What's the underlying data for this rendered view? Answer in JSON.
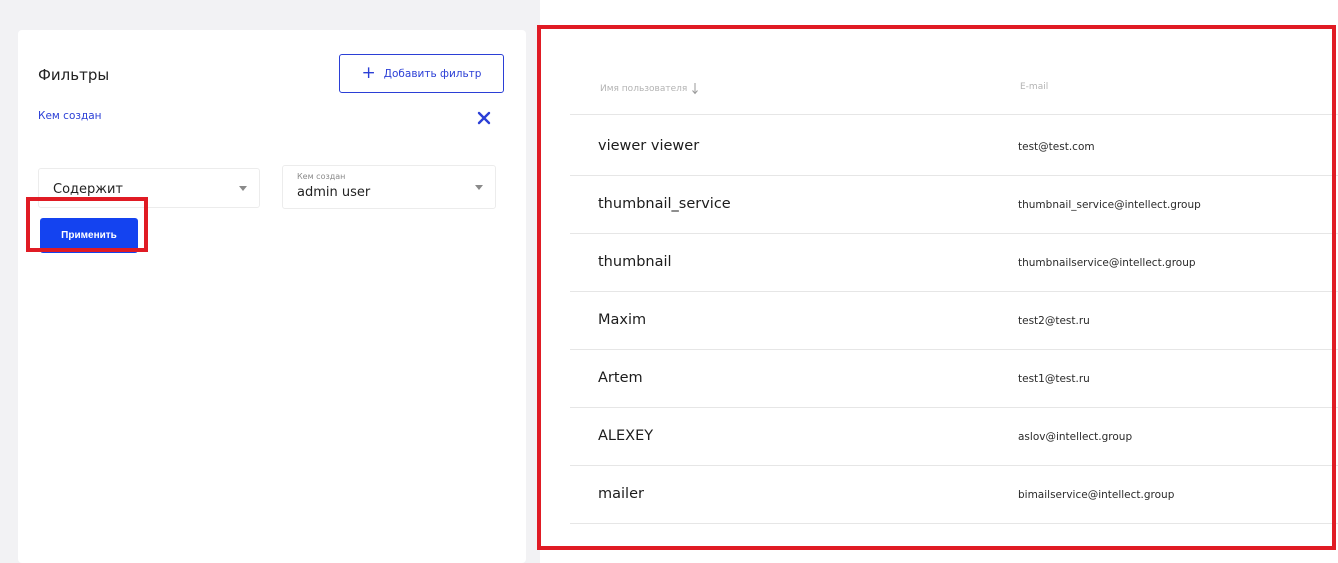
{
  "filters": {
    "title": "Фильтры",
    "add_filter_label": "Добавить фильтр",
    "add_filter_icon": "+",
    "field_name": "Кем создан",
    "condition_value": "Содержит",
    "value_floating_label": "Кем создан",
    "value_selected": "admin user",
    "apply_label": "Применить"
  },
  "table": {
    "columns": {
      "username": "Имя пользователя",
      "email": "E-mail"
    },
    "rows": [
      {
        "name": "viewer viewer",
        "email": "test@test.com"
      },
      {
        "name": "thumbnail_service",
        "email": "thumbnail_service@intellect.group"
      },
      {
        "name": "thumbnail",
        "email": "thumbnailservice@intellect.group"
      },
      {
        "name": "Maxim",
        "email": "test2@test.ru"
      },
      {
        "name": "Artem",
        "email": "test1@test.ru"
      },
      {
        "name": "ALEXEY",
        "email": "aslov@intellect.group"
      },
      {
        "name": "mailer",
        "email": "bimailservice@intellect.group"
      }
    ]
  },
  "colors": {
    "accent": "#1443f0",
    "highlight": "#e01b24"
  },
  "icons": {
    "remove_filter": "close-icon",
    "sort": "sort-down-icon",
    "dropdown": "chevron-down-icon"
  }
}
